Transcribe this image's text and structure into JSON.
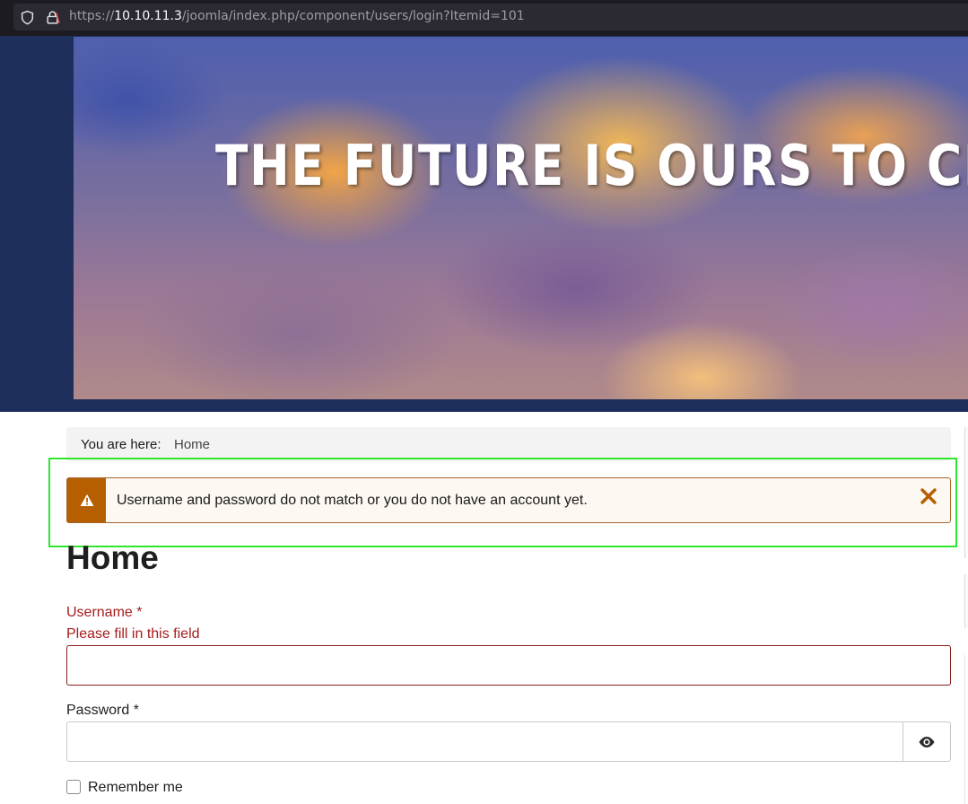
{
  "browser": {
    "url_prefix": "https://",
    "url_host": "10.10.11.3",
    "url_path": "/joomla/index.php/component/users/login?Itemid=101"
  },
  "banner": {
    "text": "THE FUTURE IS OURS TO CRE"
  },
  "breadcrumb": {
    "label": "You are here:",
    "home": "Home"
  },
  "alert": {
    "message": "Username and password do not match or you do not have an account yet.",
    "icon": "warning-icon",
    "close_icon": "close-icon"
  },
  "page": {
    "title": "Home"
  },
  "form": {
    "username_label": "Username *",
    "username_error": "Please fill in this field",
    "username_value": "",
    "password_label": "Password *",
    "password_value": "",
    "password_toggle_icon": "eye-icon",
    "remember_label": "Remember me",
    "remember_checked": false
  },
  "colors": {
    "alert_accent": "#b65f00",
    "error_text": "#a51c1c",
    "highlight": "#2fe62f"
  }
}
